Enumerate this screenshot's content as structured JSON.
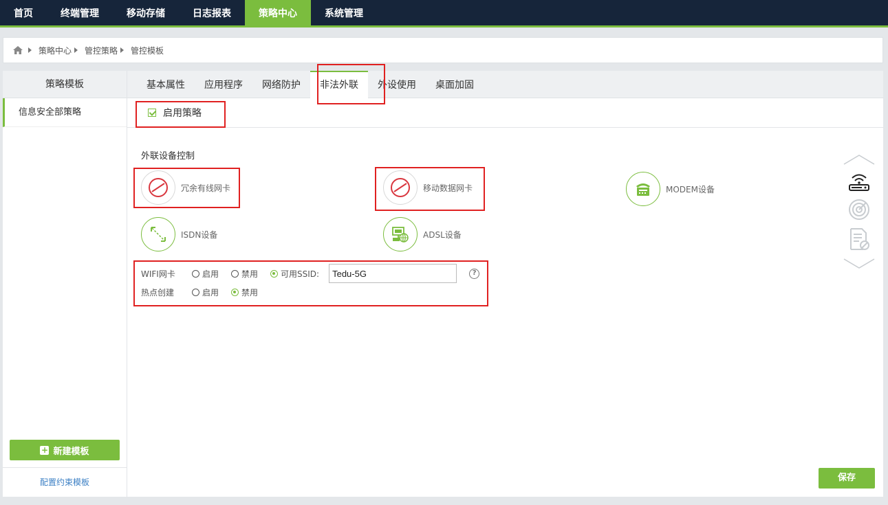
{
  "nav": {
    "items": [
      {
        "label": "首页"
      },
      {
        "label": "终端管理"
      },
      {
        "label": "移动存储"
      },
      {
        "label": "日志报表"
      },
      {
        "label": "策略中心"
      },
      {
        "label": "系统管理"
      }
    ],
    "active_index": 4
  },
  "breadcrumb": {
    "items": [
      "策略中心",
      "管控策略",
      "管控模板"
    ]
  },
  "sidebar": {
    "header": "策略模板",
    "items": [
      {
        "label": "信息安全部策略"
      }
    ],
    "new_button": "新建模板",
    "config_link": "配置约束模板"
  },
  "tabs": {
    "items": [
      {
        "label": "基本属性"
      },
      {
        "label": "应用程序"
      },
      {
        "label": "网络防护"
      },
      {
        "label": "非法外联"
      },
      {
        "label": "外设使用"
      },
      {
        "label": "桌面加固"
      }
    ],
    "active_index": 3
  },
  "enable": {
    "label": "启用策略",
    "checked": true
  },
  "section": {
    "title": "外联设备控制"
  },
  "devices": [
    {
      "label": "冗余有线网卡",
      "state": "disabled"
    },
    {
      "label": "移动数据网卡",
      "state": "disabled"
    },
    {
      "label": "MODEM设备",
      "state": "enabled"
    },
    {
      "label": "ISDN设备",
      "state": "enabled"
    },
    {
      "label": "ADSL设备",
      "state": "enabled"
    }
  ],
  "wifi": {
    "label": "WIFI网卡",
    "options": [
      "启用",
      "禁用",
      "可用SSID:"
    ],
    "selected": "可用SSID:",
    "ssid_value": "Tedu-5G",
    "help": "?"
  },
  "hotspot": {
    "label": "热点创建",
    "options": [
      "启用",
      "禁用"
    ],
    "selected": "禁用"
  },
  "save_button": "保存",
  "colors": {
    "accent": "#7bbd3e",
    "nav_bg": "#16253a",
    "highlight": "#e02020",
    "disabled_icon": "#d9363e"
  }
}
